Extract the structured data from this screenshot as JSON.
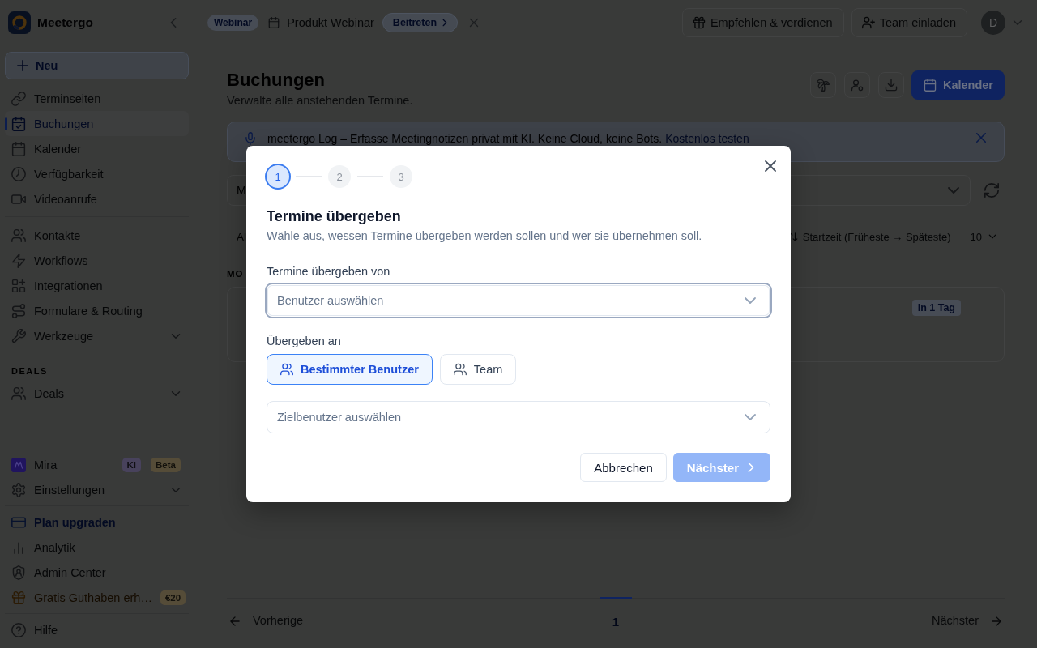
{
  "sidebar": {
    "brand": "Meetergo",
    "new_button": "Neu",
    "sections": [
      {
        "items": [
          {
            "label": "Terminseiten",
            "kind": "link",
            "selected": false
          },
          {
            "label": "Buchungen",
            "kind": "link",
            "selected": true
          },
          {
            "label": "Kalender",
            "kind": "link",
            "selected": false
          },
          {
            "label": "Verfügbarkeit",
            "kind": "link",
            "selected": false
          },
          {
            "label": "Videoanrufe",
            "kind": "link",
            "selected": false
          }
        ]
      },
      {
        "items": [
          {
            "label": "Kontakte",
            "kind": "link",
            "selected": false
          },
          {
            "label": "Workflows",
            "kind": "link",
            "selected": false
          },
          {
            "label": "Integrationen",
            "kind": "link",
            "selected": false
          },
          {
            "label": "Formulare & Routing",
            "kind": "link",
            "selected": false
          },
          {
            "label": "Werkzeuge",
            "kind": "menu",
            "selected": false
          }
        ]
      },
      {
        "heading": "DEALS",
        "items": [
          {
            "label": "Deals",
            "kind": "menu",
            "selected": false
          }
        ]
      }
    ],
    "footer_sections": [
      {
        "items": [
          {
            "label": "Mira",
            "kind": "link",
            "selected": false,
            "badges": [
              {
                "text": "KI",
                "color": "#48425c"
              },
              {
                "text": "Beta",
                "color": "#554c38"
              }
            ]
          },
          {
            "label": "Einstellungen",
            "kind": "menu",
            "selected": false
          }
        ]
      },
      {
        "items": [
          {
            "label": "Plan upgraden",
            "kind": "upgrade",
            "selected": false
          },
          {
            "label": "Analytik",
            "kind": "link",
            "selected": false
          },
          {
            "label": "Admin Center",
            "kind": "link",
            "selected": false
          },
          {
            "label": "Gratis Guthaben erh…",
            "kind": "promo",
            "selected": false,
            "badges": [
              {
                "text": "€20",
                "color": "#554c38"
              }
            ]
          }
        ]
      },
      {
        "items": [
          {
            "label": "Hilfe",
            "kind": "link",
            "selected": false
          }
        ]
      }
    ]
  },
  "top_bar": {
    "event": {
      "type": "Webinar",
      "title": "Produkt Webinar",
      "join_button": "Beitreten"
    },
    "buttons": [
      "Empfehlen & verdienen",
      "Team einladen"
    ],
    "avatar": "D"
  },
  "page": {
    "title": "Buchungen",
    "subtitle": "Verwalte alle anstehenden Termine.",
    "calendar_button": "Kalender",
    "banner": {
      "text": "meetergo Log – Erfasse Meetingnotizen privat mit KI. Keine Cloud, keine Bots.",
      "link": "Kostenlos testen"
    },
    "filter_select": {
      "value": "M"
    },
    "toolbar": {
      "left_control": "Al",
      "sort": "Startzeit (Früheste → Späteste)",
      "page_size": "10"
    },
    "list": {
      "section_heading": "MO",
      "card_badge": "in 1 Tag"
    },
    "pagination": {
      "previous": "Vorherige",
      "pages": [
        {
          "label": "1",
          "selected": true
        }
      ],
      "next": "Nächster"
    }
  },
  "dialog": {
    "steps": [
      {
        "label": "1",
        "selected": true
      },
      {
        "label": "2",
        "selected": false
      },
      {
        "label": "3",
        "selected": false
      }
    ],
    "title": "Termine übergeben",
    "description": "Wähle aus, wessen Termine übergeben werden sollen und wer sie übernehmen soll.",
    "source_label": "Termine übergeben von",
    "source_select": {
      "placeholder": "Benutzer auswählen",
      "focused": true
    },
    "target_label": "Übergeben an",
    "target_options": [
      {
        "label": "Bestimmter Benutzer",
        "selected": true
      },
      {
        "label": "Team",
        "selected": false
      }
    ],
    "target_select": {
      "placeholder": "Zielbenutzer auswählen",
      "focused": false
    },
    "buttons": [
      {
        "label": "Abbrechen",
        "kind": "secondary",
        "disabled": false
      },
      {
        "label": "Nächster",
        "kind": "primary",
        "disabled": true
      }
    ]
  }
}
